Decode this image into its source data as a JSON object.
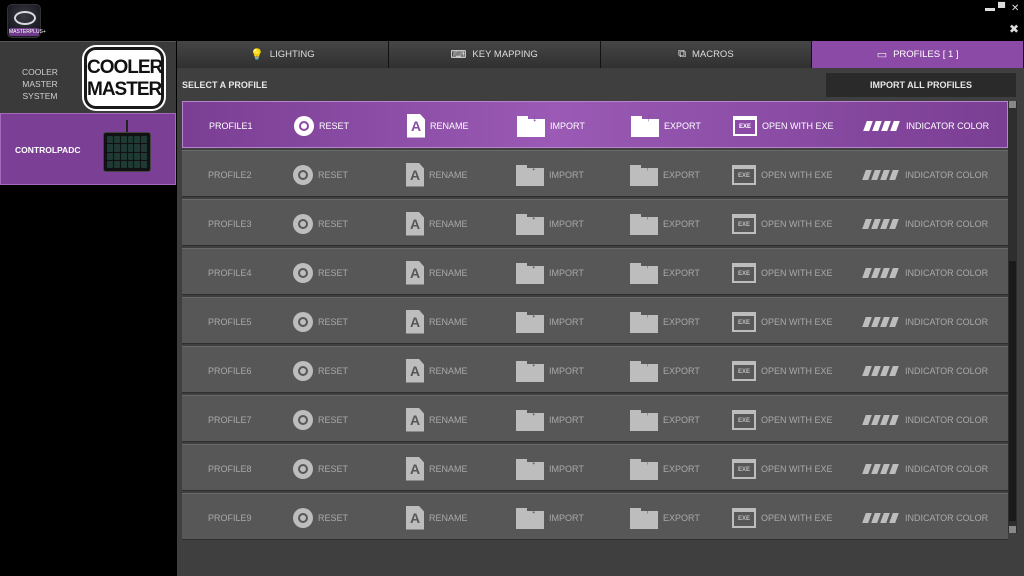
{
  "app": {
    "logo_text": "MASTERPLUS+"
  },
  "window": {
    "minimize": "▬",
    "maximize": "▀",
    "close": "✕",
    "tools": "✖"
  },
  "sidebar": {
    "devices": [
      {
        "label": "COOLER MASTER SYSTEM",
        "logo_text": "COOLER MASTER"
      },
      {
        "label": "CONTROLPADC"
      }
    ]
  },
  "tabs": [
    {
      "label": "LIGHTING",
      "icon": "lightbulb-icon"
    },
    {
      "label": "KEY MAPPING",
      "icon": "keyboard-icon"
    },
    {
      "label": "MACROS",
      "icon": "macro-icon"
    },
    {
      "label": "PROFILES [ 1 ]",
      "icon": "profile-icon",
      "active": true
    }
  ],
  "content": {
    "select_label": "SELECT A PROFILE",
    "import_all_label": "IMPORT ALL PROFILES",
    "actions": {
      "reset": "RESET",
      "rename": "RENAME",
      "import": "IMPORT",
      "export": "EXPORT",
      "open_exe": "OPEN WITH EXE",
      "exe_icon_text": "EXE",
      "rename_icon_text": "A",
      "indicator": "INDICATOR COLOR"
    },
    "profiles": [
      "PROFILE1",
      "PROFILE2",
      "PROFILE3",
      "PROFILE4",
      "PROFILE5",
      "PROFILE6",
      "PROFILE7",
      "PROFILE8",
      "PROFILE9"
    ],
    "active_profile": "PROFILE1"
  },
  "colors": {
    "accent": "#8b4aa6",
    "row": "#575757",
    "background": "#3f3f3f"
  }
}
